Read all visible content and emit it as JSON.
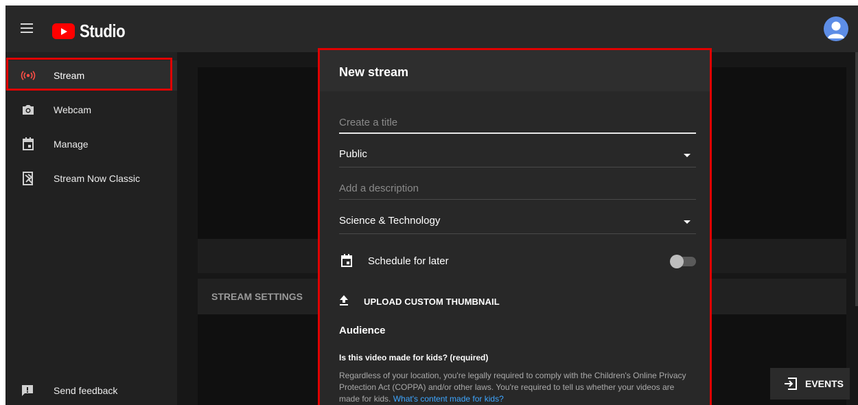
{
  "app": {
    "logo_text": "Studio",
    "colors": {
      "brand_red": "#ff0000",
      "highlight_red": "#e00000",
      "link_blue": "#3ea6ff",
      "avatar_blue": "#5d8de6"
    }
  },
  "sidebar": {
    "items": [
      {
        "label": "Stream",
        "icon": "live-broadcast-icon",
        "active": true
      },
      {
        "label": "Webcam",
        "icon": "camera-icon",
        "active": false
      },
      {
        "label": "Manage",
        "icon": "calendar-icon",
        "active": false
      },
      {
        "label": "Stream Now Classic",
        "icon": "stream-classic-icon",
        "active": false
      }
    ],
    "feedback_label": "Send feedback"
  },
  "main": {
    "stream_settings_label": "STREAM SETTINGS",
    "events_label": "EVENTS"
  },
  "modal": {
    "title": "New stream",
    "title_placeholder": "Create a title",
    "title_value": "",
    "visibility_value": "Public",
    "description_placeholder": "Add a description",
    "category_value": "Science & Technology",
    "schedule_label": "Schedule for later",
    "schedule_enabled": false,
    "upload_thumbnail_label": "UPLOAD CUSTOM THUMBNAIL",
    "audience_heading": "Audience",
    "kids_question": "Is this video made for kids? (required)",
    "kids_text": "Regardless of your location, you're legally required to comply with the Children's Online Privacy Protection Act (COPPA) and/or other laws. You're required to tell us whether your videos are made for kids.",
    "kids_link": "What's content made for kids?"
  }
}
